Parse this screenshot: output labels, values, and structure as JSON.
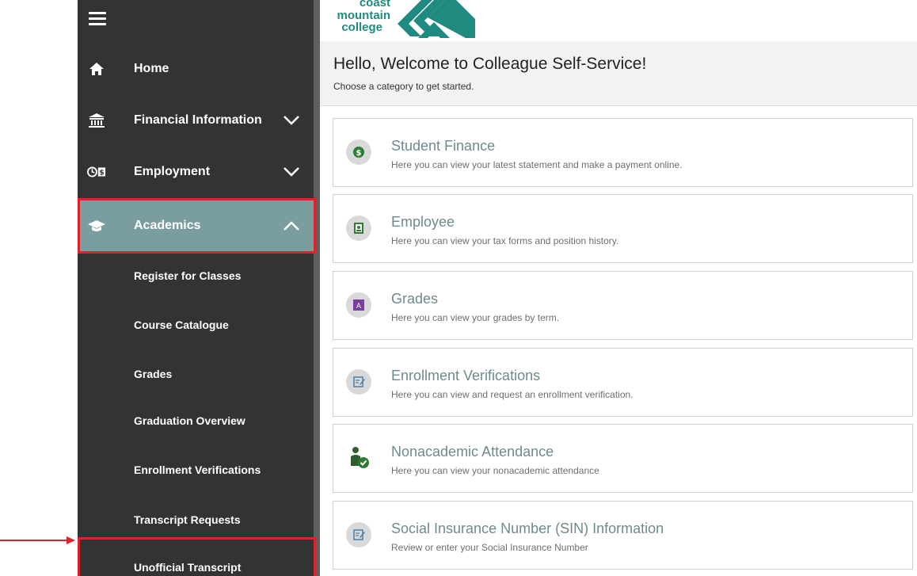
{
  "brand": {
    "logo_line1": "coast",
    "logo_line2": "mountain",
    "logo_line3": "college",
    "accent_color": "#1f8a80"
  },
  "sidebar": {
    "menu_icon": "hamburger-icon",
    "items": [
      {
        "label": "Home",
        "icon": "home-icon"
      },
      {
        "label": "Financial Information",
        "icon": "bank-icon",
        "chevron": "chevron-down-icon"
      },
      {
        "label": "Employment",
        "icon": "employment-icon",
        "chevron": "chevron-down-icon"
      },
      {
        "label": "Academics",
        "icon": "graduation-cap-icon",
        "chevron": "chevron-up-icon",
        "active": true
      }
    ],
    "sub_items": [
      {
        "label": "Register for Classes"
      },
      {
        "label": "Course Catalogue"
      },
      {
        "label": "Grades"
      },
      {
        "label": "Graduation Overview"
      },
      {
        "label": "Enrollment Verifications"
      },
      {
        "label": "Transcript Requests"
      },
      {
        "label": "Unofficial Transcript"
      }
    ],
    "active_color": "#7a9e9f",
    "background_color": "#333333"
  },
  "welcome": {
    "title": "Hello, Welcome to Colleague Self-Service!",
    "subtitle": "Choose a category to get started."
  },
  "cards": [
    {
      "title": "Student Finance",
      "description": "Here you can view your latest statement and make a payment online.",
      "icon": "dollar-icon"
    },
    {
      "title": "Employee",
      "description": "Here you can view your tax forms and position history.",
      "icon": "id-badge-icon"
    },
    {
      "title": "Grades",
      "description": "Here you can view your grades by term.",
      "icon": "grade-icon"
    },
    {
      "title": "Enrollment Verifications",
      "description": "Here you can view and request an enrollment verification.",
      "icon": "document-edit-icon"
    },
    {
      "title": "Nonacademic Attendance",
      "description": "Here you can view your nonacademic attendance",
      "icon": "attendance-check-icon"
    },
    {
      "title": "Social Insurance Number (SIN) Information",
      "description": "Review or enter your Social Insurance Number",
      "icon": "document-edit-icon"
    }
  ],
  "annotation": {
    "highlight_color": "#d9242b"
  }
}
